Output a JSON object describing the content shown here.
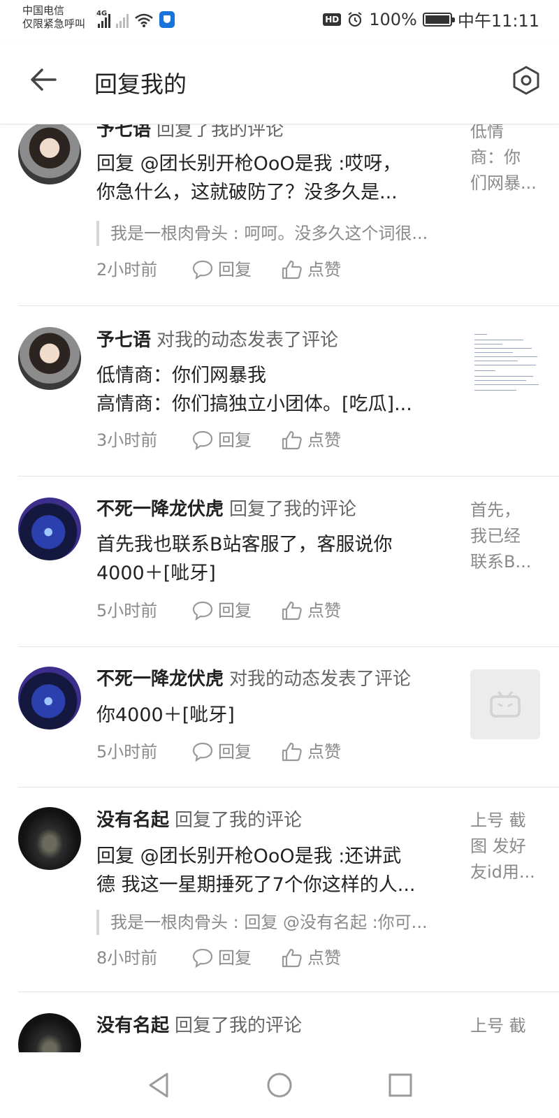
{
  "status_bar": {
    "carrier_line1": "中国电信",
    "carrier_line2": "仅限紧急呼叫",
    "network_tag": "4G",
    "hd_badge": "HD",
    "battery": "100%",
    "time": "中午11:11"
  },
  "header": {
    "title": "回复我的"
  },
  "list": {
    "reply_label": "回复",
    "like_label": "点赞",
    "items": [
      {
        "username": "予七语",
        "action": "回复了我的评论",
        "content_lines": [
          "回复 @团长别开枪OoO是我 :哎呀，",
          "你急什么，这就破防了？没多久是..."
        ],
        "quote": "我是一根肉骨头 : 呵呵。没多久这个词很...",
        "time": "2小时前",
        "preview_lines": [
          "低情",
          "商：你",
          "们网暴..."
        ]
      },
      {
        "username": "予七语",
        "action": "对我的动态发表了评论",
        "content_lines": [
          "低情商：你们网暴我",
          "高情商：你们搞独立小团体。[吃瓜]..."
        ],
        "time": "3小时前"
      },
      {
        "username": "不死一降龙伏虎",
        "action": "回复了我的评论",
        "content_lines": [
          "首先我也联系B站客服了，客服说你",
          "4000＋[呲牙]"
        ],
        "time": "5小时前",
        "preview_lines": [
          "首先，",
          "我已经",
          "联系B..."
        ]
      },
      {
        "username": "不死一降龙伏虎",
        "action": "对我的动态发表了评论",
        "content_lines": [
          "你4000＋[呲牙]"
        ],
        "time": "5小时前"
      },
      {
        "username": "没有名起",
        "action": "回复了我的评论",
        "content_lines": [
          "回复 @团长别开枪OoO是我 :还讲武",
          "德 我这一星期捶死了7个你这样的人..."
        ],
        "quote": "我是一根肉骨头 : 回复 @没有名起 :你可...",
        "time": "8小时前",
        "preview_lines": [
          "上号 截",
          "图 发好",
          "友id用..."
        ]
      },
      {
        "username": "没有名起",
        "action": "回复了我的评论",
        "preview_lines": [
          "上号 截"
        ]
      }
    ]
  },
  "colors": {
    "text_primary": "#222222",
    "text_secondary": "#8a8a8a",
    "divider": "#e4e4e4",
    "quote_bar": "#d6d6d6"
  },
  "icons": [
    "back-arrow-icon",
    "settings-hex-icon",
    "comment-icon",
    "thumbs-up-icon",
    "bilibili-tv-icon",
    "nav-back-triangle-icon",
    "nav-home-circle-icon",
    "nav-recents-square-icon"
  ]
}
